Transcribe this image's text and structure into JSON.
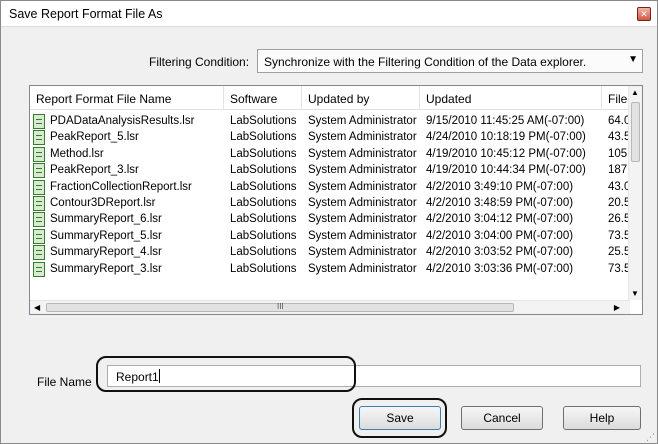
{
  "window": {
    "title": "Save Report Format File As",
    "close_label": "✕"
  },
  "filter": {
    "label": "Filtering Condition:",
    "selected": "Synchronize with the Filtering Condition of the Data explorer.",
    "arrow": "▼"
  },
  "list": {
    "columns": [
      "Report Format File Name",
      "Software",
      "Updated by",
      "Updated",
      "File"
    ],
    "rows": [
      {
        "name": "PDADataAnalysisResults.lsr",
        "software": "LabSolutions",
        "updated_by": "System Administrator",
        "updated": "9/15/2010 11:45:25 AM(-07:00)",
        "file": "64.0"
      },
      {
        "name": "PeakReport_5.lsr",
        "software": "LabSolutions",
        "updated_by": "System Administrator",
        "updated": "4/24/2010 10:18:19 PM(-07:00)",
        "file": "43.5"
      },
      {
        "name": "Method.lsr",
        "software": "LabSolutions",
        "updated_by": "System Administrator",
        "updated": "4/19/2010 10:45:12 PM(-07:00)",
        "file": "105"
      },
      {
        "name": "PeakReport_3.lsr",
        "software": "LabSolutions",
        "updated_by": "System Administrator",
        "updated": "4/19/2010 10:44:34 PM(-07:00)",
        "file": "187"
      },
      {
        "name": "FractionCollectionReport.lsr",
        "software": "LabSolutions",
        "updated_by": "System Administrator",
        "updated": "4/2/2010 3:49:10 PM(-07:00)",
        "file": "43.0"
      },
      {
        "name": "Contour3DReport.lsr",
        "software": "LabSolutions",
        "updated_by": "System Administrator",
        "updated": "4/2/2010 3:48:59 PM(-07:00)",
        "file": "20.5"
      },
      {
        "name": "SummaryReport_6.lsr",
        "software": "LabSolutions",
        "updated_by": "System Administrator",
        "updated": "4/2/2010 3:04:12 PM(-07:00)",
        "file": "26.5"
      },
      {
        "name": "SummaryReport_5.lsr",
        "software": "LabSolutions",
        "updated_by": "System Administrator",
        "updated": "4/2/2010 3:04:00 PM(-07:00)",
        "file": "73.5"
      },
      {
        "name": "SummaryReport_4.lsr",
        "software": "LabSolutions",
        "updated_by": "System Administrator",
        "updated": "4/2/2010 3:03:52 PM(-07:00)",
        "file": "25.5"
      },
      {
        "name": "SummaryReport_3.lsr",
        "software": "LabSolutions",
        "updated_by": "System Administrator",
        "updated": "4/2/2010 3:03:36 PM(-07:00)",
        "file": "73.5"
      }
    ],
    "scroll_grip": "III"
  },
  "file_name": {
    "label": "File Name",
    "value": "Report1"
  },
  "buttons": {
    "save": "Save",
    "cancel": "Cancel",
    "help": "Help"
  },
  "colors": {
    "dialog_bg": "#f0f0f0",
    "close_button": "#d0553f",
    "highlight_outline": "#111111"
  }
}
